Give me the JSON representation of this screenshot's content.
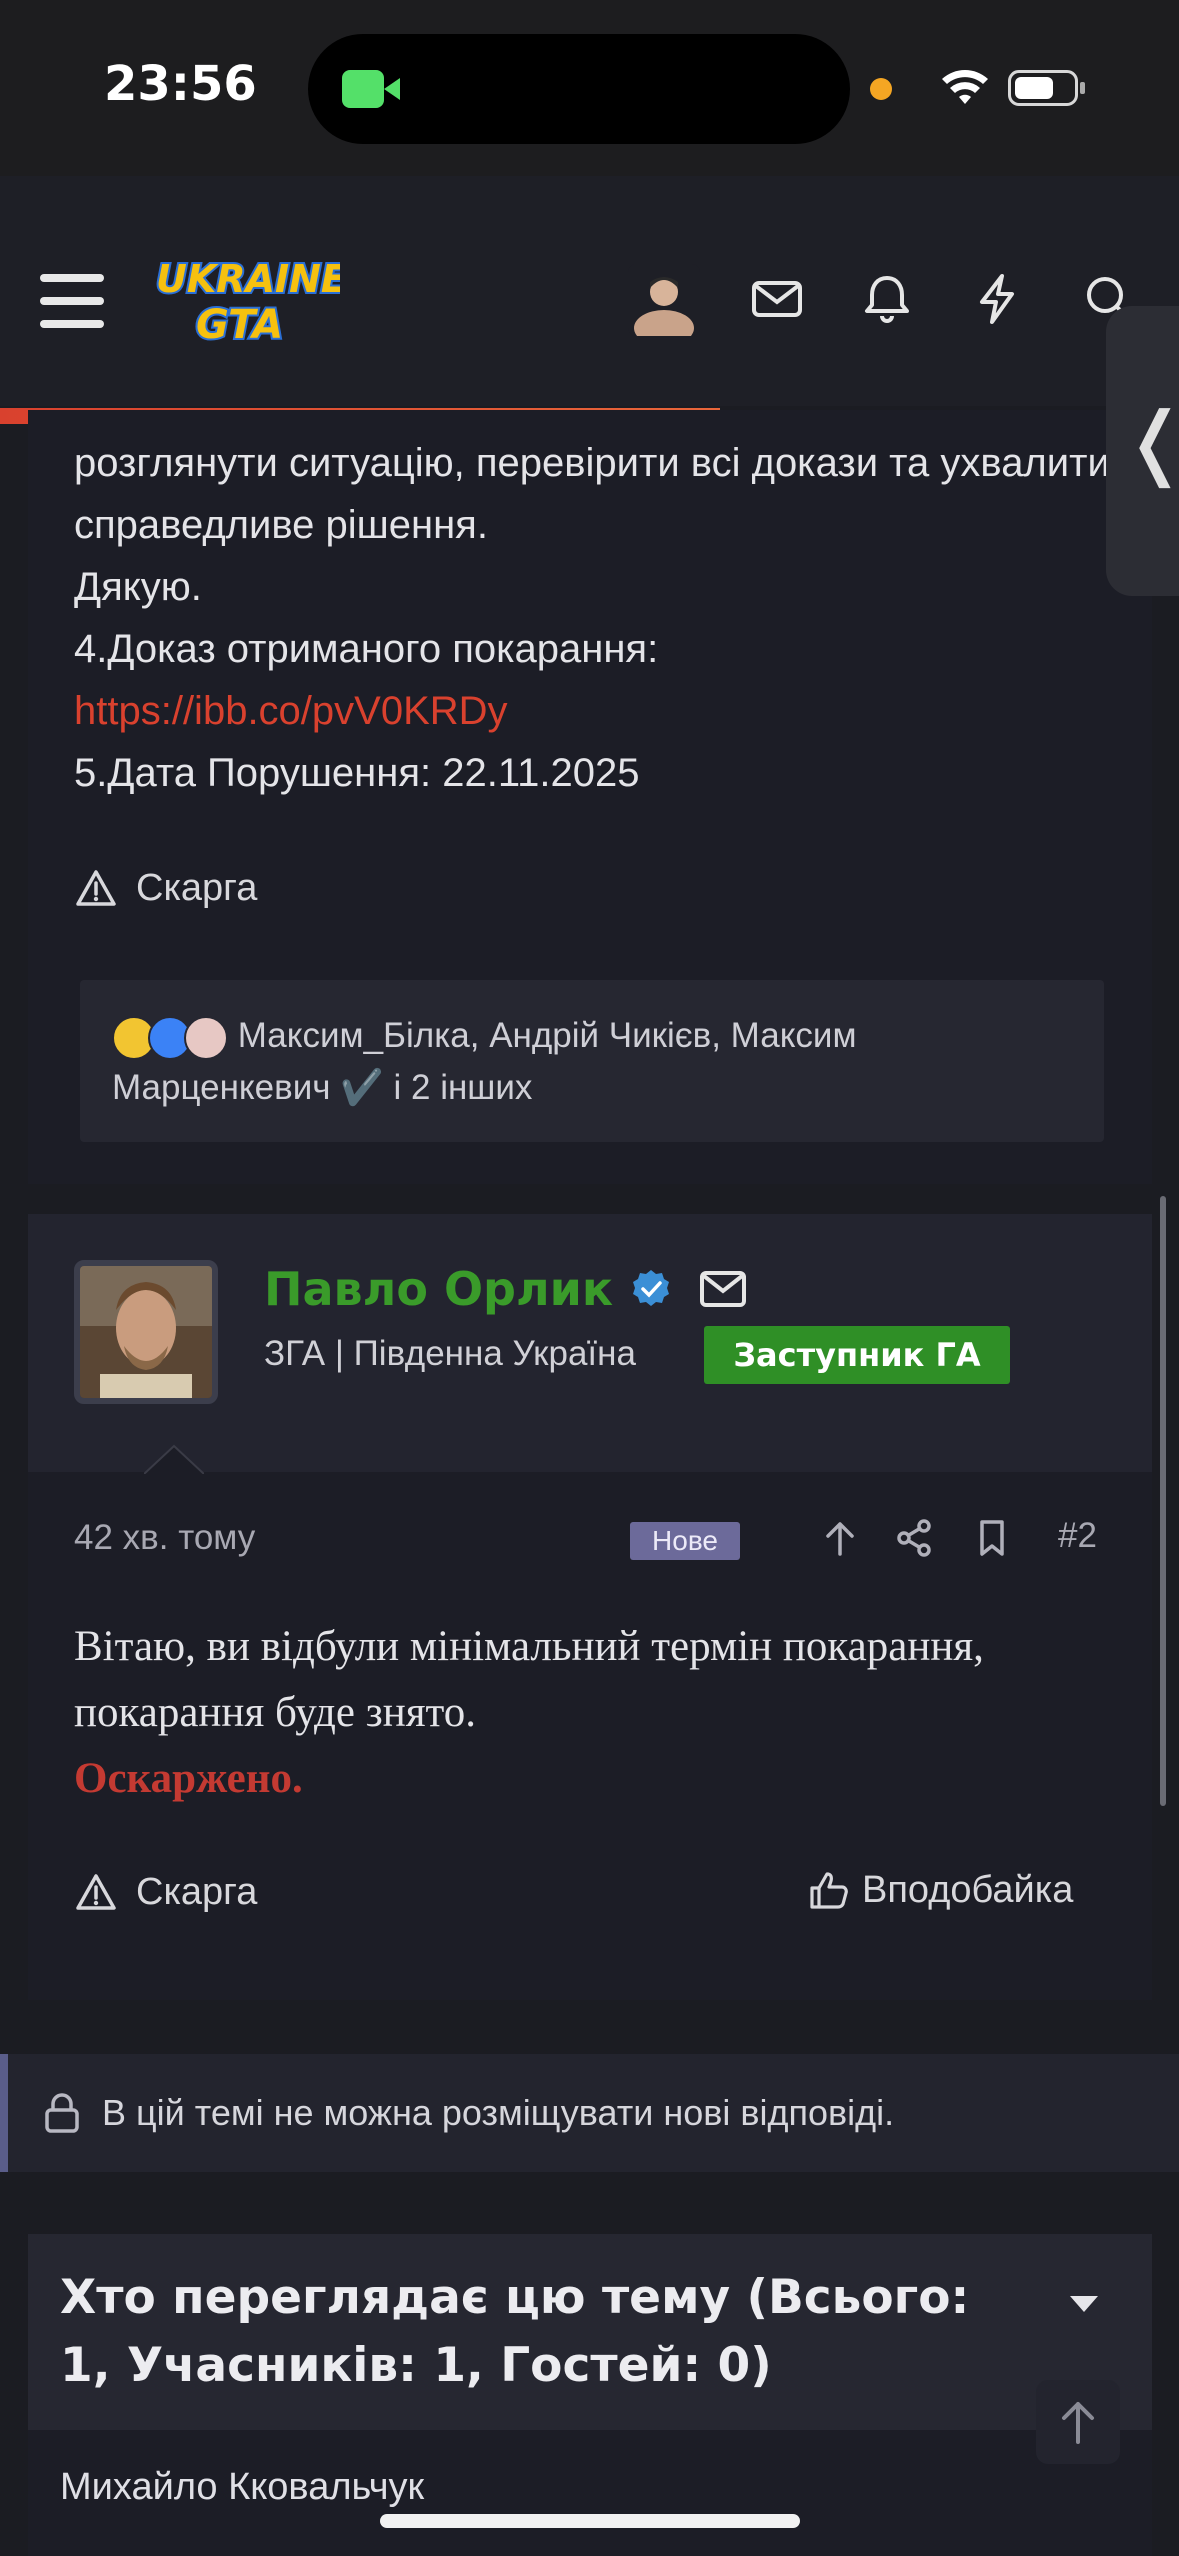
{
  "status_bar": {
    "time": "23:56"
  },
  "post1": {
    "lines": [
      "розглянути ситуацію, перевірити всі докази та ухвалити справедливе рішення.",
      "Дякую.",
      "4.Доказ отриманого покарання:"
    ],
    "link": "https://ibb.co/pvV0KRDy",
    "date_line": "5.Дата Порушення: 22.11.2025",
    "report_label": "Скарга",
    "reactions_text": "Максим_Білка, Андрій Чикієв, Максим Марценкевич ✔️ і 2 інших"
  },
  "post2": {
    "author": "Павло Орлик",
    "subtitle": "ЗГА | Південна Україна",
    "role_badge": "Заступник ГА",
    "time": "42 хв. тому",
    "new_badge": "Нове",
    "post_number": "#2",
    "text": "Вітаю, ви відбули мінімальний термін покарання, покарання буде знято.",
    "highlight": "Оскаржено.",
    "report_label": "Скарга",
    "like_label": "Вподобайка"
  },
  "closed_notice": "В цій темі не можна розміщувати нові відповіді.",
  "viewers": {
    "title": "Хто переглядає цю тему (Всього: 1, Учасників: 1, Гостей: 0)",
    "names": [
      "Михайло Кковальчук"
    ]
  },
  "icons": {
    "menu": "menu-icon",
    "mail": "mail-icon",
    "bell": "bell-icon",
    "bolt": "bolt-icon",
    "search": "search-icon",
    "warning": "warning-icon",
    "lock": "lock-icon",
    "thumbs_up": "thumbs-up-icon",
    "share": "share-icon",
    "bookmark": "bookmark-icon",
    "arrow_up": "arrow-up-icon"
  },
  "colors": {
    "accent": "#d9412e",
    "author_green": "#3a9b2a",
    "badge_green": "#2f8f26",
    "new_badge": "#6c6a9a"
  }
}
